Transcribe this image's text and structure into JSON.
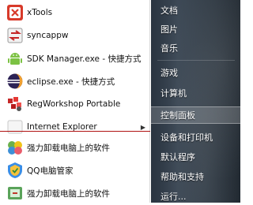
{
  "start_menu": {
    "programs": [
      {
        "label": "xTools",
        "icon": "xtools-icon"
      },
      {
        "label": "syncappw",
        "icon": "syncappw-icon"
      },
      {
        "label": "SDK Manager.exe - 快捷方式",
        "icon": "android-icon"
      },
      {
        "label": "eclipse.exe - 快捷方式",
        "icon": "eclipse-icon"
      },
      {
        "label": "RegWorkshop Portable",
        "icon": "regworkshop-icon"
      },
      {
        "label": "Internet Explorer",
        "icon": "ie-icon"
      },
      {
        "label": "强力卸载电脑上的软件",
        "icon": "uninstall-icon"
      },
      {
        "label": "QQ电脑管家",
        "icon": "qq-guard-icon"
      },
      {
        "label": "强力卸载电脑上的软件",
        "icon": "uninstall-icon"
      }
    ],
    "right_items": [
      {
        "label": "文档"
      },
      {
        "label": "图片"
      },
      {
        "label": "音乐"
      },
      {
        "label": "游戏"
      },
      {
        "label": "计算机"
      },
      {
        "label": "控制面板"
      },
      {
        "label": "设备和打印机"
      },
      {
        "label": "默认程序"
      },
      {
        "label": "帮助和支持"
      },
      {
        "label": "运行..."
      }
    ],
    "colors": {
      "highlight_separator": "#b01010",
      "right_pane": "#2f3a45"
    }
  }
}
